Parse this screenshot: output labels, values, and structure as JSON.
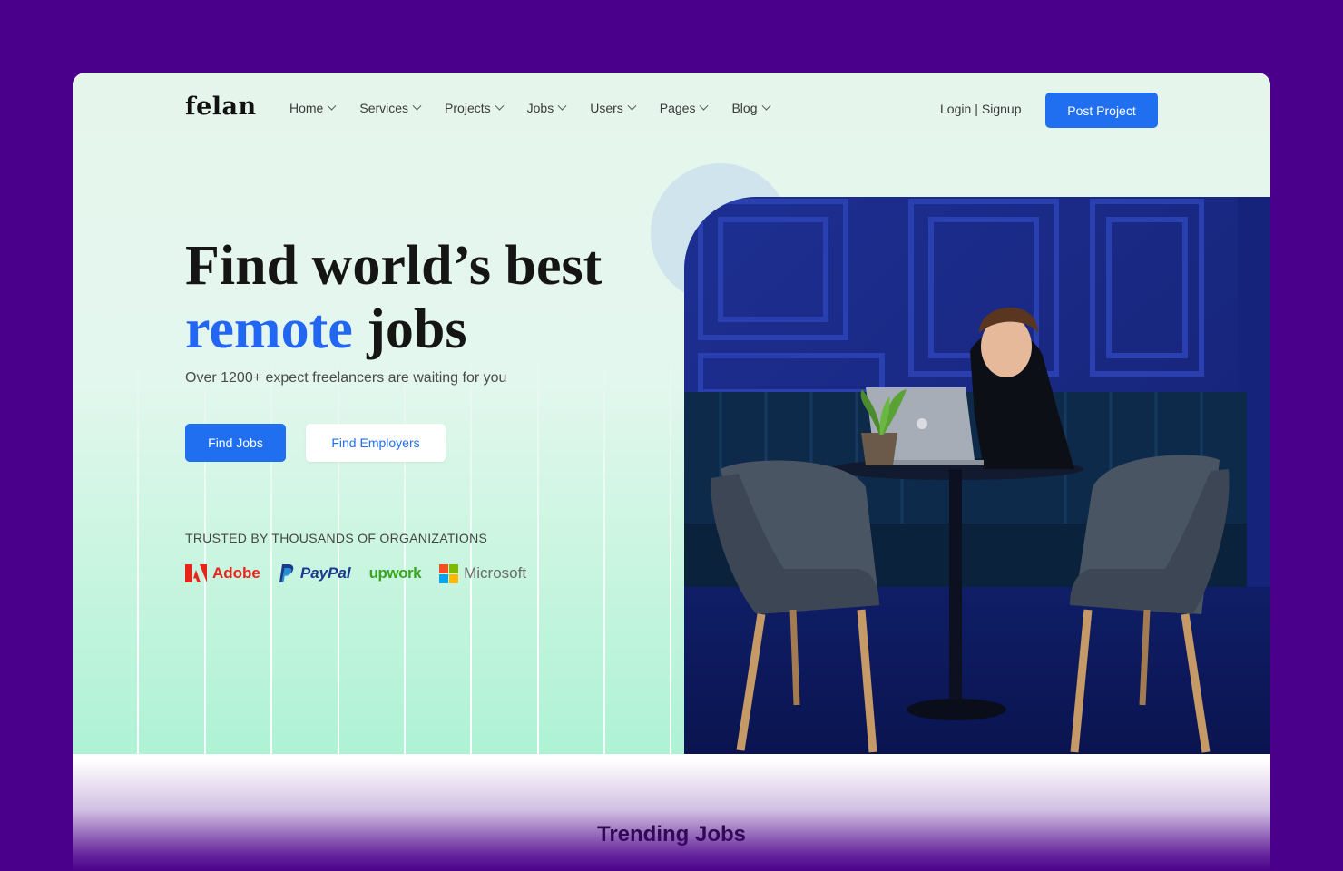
{
  "brand": {
    "logo": "felan"
  },
  "nav": {
    "items": [
      {
        "label": "Home"
      },
      {
        "label": "Services"
      },
      {
        "label": "Projects"
      },
      {
        "label": "Jobs"
      },
      {
        "label": "Users"
      },
      {
        "label": "Pages"
      },
      {
        "label": "Blog"
      }
    ],
    "login_label": "Login",
    "divider": "|",
    "signup_label": "Signup",
    "post_project_label": "Post Project"
  },
  "hero": {
    "title_line1": "Find world’s best",
    "title_accent": "remote",
    "title_rest": "jobs",
    "subtitle": "Over 1200+ expect freelancers are waiting for you",
    "primary_cta": "Find Jobs",
    "secondary_cta": "Find Employers",
    "trusted_label": "TRUSTED BY THOUSANDS OF ORGANIZATIONS",
    "brands": [
      {
        "name": "Adobe",
        "icon": "adobe-logo"
      },
      {
        "name": "PayPal",
        "icon": "paypal-logo"
      },
      {
        "name": "upwork",
        "icon": "upwork-logo"
      },
      {
        "name": "Microsoft",
        "icon": "microsoft-logo"
      }
    ]
  },
  "section": {
    "trending_title": "Trending Jobs"
  },
  "colors": {
    "accent": "#1f6ff0",
    "page_background": "#4b008b",
    "hero_top": "#e6f5ec",
    "hero_bottom": "#aef2d4"
  }
}
